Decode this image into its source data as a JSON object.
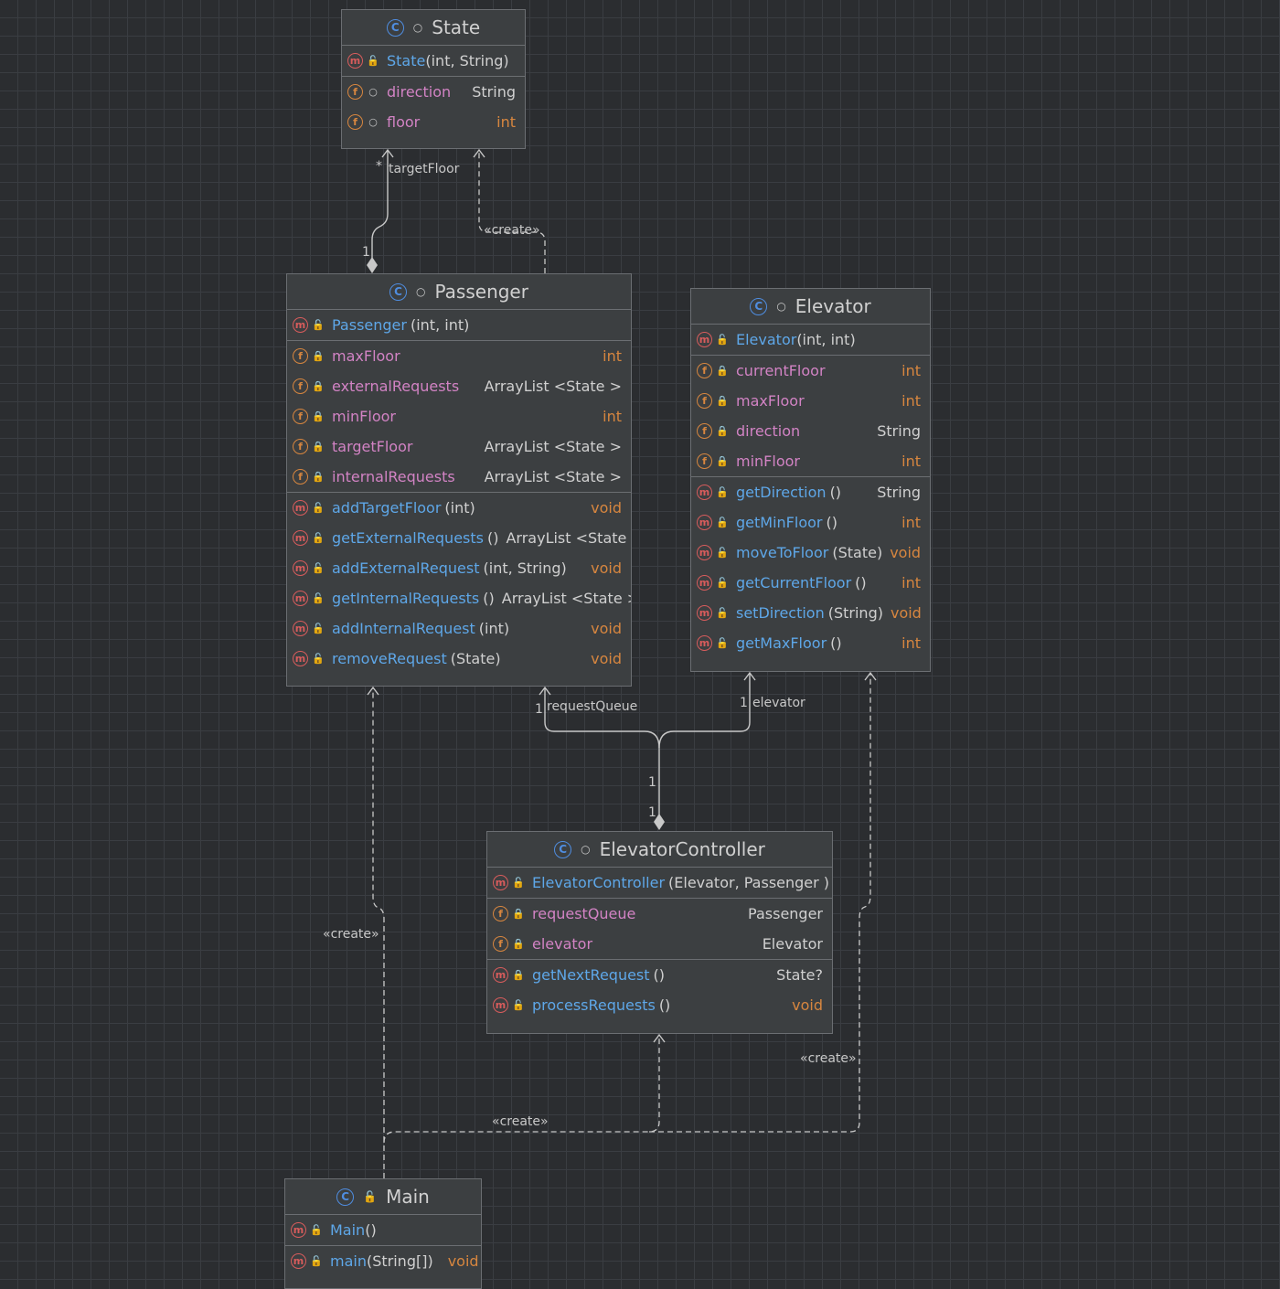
{
  "colors": {
    "background": "#2b2d30",
    "grid": "#3a3d42",
    "node_fill": "#3c3f41",
    "method_name": "#5ea7e8",
    "field_name": "#d283c4",
    "primitive_type": "#d7863f",
    "method_badge": "#d85c5c",
    "field_badge": "#d7863f",
    "class_badge": "#4f8de0",
    "public_icon": "#5fa85f",
    "private_icon": "#d85c5c"
  },
  "badges": {
    "class": "C",
    "method": "m",
    "field": "f"
  },
  "classes": {
    "state": {
      "name": "State",
      "constructor": {
        "name": "State",
        "params": "(int, String)"
      },
      "fields": [
        {
          "name": "direction",
          "type": "String"
        },
        {
          "name": "floor",
          "type": "int"
        }
      ]
    },
    "passenger": {
      "name": "Passenger",
      "constructor": {
        "name": "Passenger",
        "params": "(int, int)"
      },
      "fields": [
        {
          "name": "maxFloor",
          "type": "int"
        },
        {
          "name": "externalRequests",
          "type": "ArrayList <State >"
        },
        {
          "name": "minFloor",
          "type": "int"
        },
        {
          "name": "targetFloor",
          "type": "ArrayList <State >"
        },
        {
          "name": "internalRequests",
          "type": "ArrayList <State >"
        }
      ],
      "methods": [
        {
          "name": "addTargetFloor",
          "params": "(int)",
          "type": "void"
        },
        {
          "name": "getExternalRequests",
          "params": "()",
          "type": "ArrayList <State >"
        },
        {
          "name": "addExternalRequest",
          "params": "(int, String)",
          "type": "void"
        },
        {
          "name": "getInternalRequests",
          "params": "()",
          "type": "ArrayList <State >"
        },
        {
          "name": "addInternalRequest",
          "params": "(int)",
          "type": "void"
        },
        {
          "name": "removeRequest",
          "params": "(State)",
          "type": "void"
        }
      ]
    },
    "elevator": {
      "name": "Elevator",
      "constructor": {
        "name": "Elevator",
        "params": "(int, int)"
      },
      "fields": [
        {
          "name": "currentFloor",
          "type": "int"
        },
        {
          "name": "maxFloor",
          "type": "int"
        },
        {
          "name": "direction",
          "type": "String"
        },
        {
          "name": "minFloor",
          "type": "int"
        }
      ],
      "methods": [
        {
          "name": "getDirection",
          "params": "()",
          "type": "String"
        },
        {
          "name": "getMinFloor",
          "params": "()",
          "type": "int"
        },
        {
          "name": "moveToFloor",
          "params": "(State)",
          "type": "void"
        },
        {
          "name": "getCurrentFloor",
          "params": "()",
          "type": "int"
        },
        {
          "name": "setDirection",
          "params": "(String)",
          "type": "void"
        },
        {
          "name": "getMaxFloor",
          "params": "()",
          "type": "int"
        }
      ]
    },
    "controller": {
      "name": "ElevatorController",
      "constructor": {
        "name": "ElevatorController",
        "params": "(Elevator, Passenger )"
      },
      "fields": [
        {
          "name": "requestQueue",
          "type": "Passenger"
        },
        {
          "name": "elevator",
          "type": "Elevator"
        }
      ],
      "methods": [
        {
          "name": "getNextRequest",
          "params": "()",
          "type": "State?"
        },
        {
          "name": "processRequests",
          "params": "()",
          "type": "void"
        }
      ]
    },
    "main": {
      "name": "Main",
      "constructor": {
        "name": "Main",
        "params": "()"
      },
      "methods": [
        {
          "name": "main",
          "params": "(String[])",
          "type": "void"
        }
      ]
    }
  },
  "relations": {
    "target_floor": {
      "role": "targetFloor",
      "mult_state": "*",
      "mult_passenger": "1"
    },
    "passenger_create": {
      "label": "«create»"
    },
    "request_queue": {
      "role": "requestQueue",
      "mult_passenger": "1",
      "mult_controller": "1"
    },
    "elevator_assoc": {
      "role": "elevator",
      "mult_elevator": "1",
      "mult_controller": "1"
    },
    "main_create_passenger": {
      "label": "«create»"
    },
    "main_create_controller": {
      "label": "«create»"
    },
    "main_create_elevator": {
      "label": "«create»"
    }
  }
}
